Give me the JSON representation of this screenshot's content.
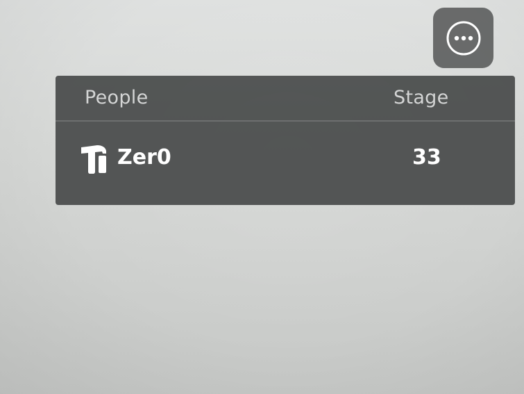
{
  "menu": {
    "icon": "more-options-icon"
  },
  "leaderboard": {
    "columns": [
      "People",
      "Stage"
    ],
    "rows": [
      {
        "icon": "hammer-icon",
        "name": "Zer0",
        "stage": "33"
      }
    ]
  },
  "colors": {
    "panel": "#4c4e4e",
    "button": "#5e6060",
    "text": "#ffffff",
    "header_text": "#d4d5d5"
  }
}
